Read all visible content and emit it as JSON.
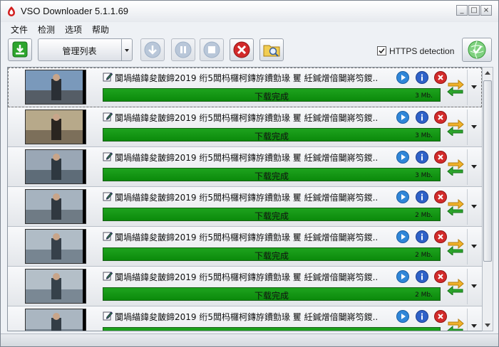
{
  "window": {
    "title": "VSO Downloader 5.1.1.69",
    "controls": {
      "minimize": "_",
      "maximize": "□",
      "close": "×"
    }
  },
  "menu": [
    {
      "label": "文件"
    },
    {
      "label": "检测"
    },
    {
      "label": "选项"
    },
    {
      "label": "帮助"
    }
  ],
  "toolbar": {
    "list_selector_label": "管理列表",
    "https_detection_label": "HTTPS detection",
    "https_detection_checked": true,
    "icons": {
      "download": "download-icon",
      "move_down": "arrow-down-icon",
      "pause": "pause-icon",
      "stop": "stop-icon",
      "cancel": "close-icon",
      "browse": "folder-search-icon",
      "status": "globe-check-icon"
    }
  },
  "downloads": [
    {
      "title": "闅堝緢鍏夋皵鍗2019 绗5闆杩欏柯鏄斿鐨勯瑑  矍   紝鍼熷偣闄嶈笉鍐..",
      "status": "下载完成",
      "size": "3 Mb."
    },
    {
      "title": "闅堝緢鍏夋皵鍗2019 绗5闆杩欏柯鏄斿鐨勯瑑  矍   紝鍼熷偣闄嶈笉鍐..",
      "status": "下载完成",
      "size": "3 Mb."
    },
    {
      "title": "闅堝緢鍏夋皵鍗2019 绗5闆杩欏柯鏄斿鐨勯瑑  矍   紝鍼熷偣闄嶈笉鍐..",
      "status": "下载完成",
      "size": "3 Mb."
    },
    {
      "title": "闅堝緢鍏夋皵鍗2019 绗5闆杩欏柯鏄斿鐨勯瑑  矍   紝鍼熷偣闄嶈笉鍐..",
      "status": "下载完成",
      "size": "2 Mb."
    },
    {
      "title": "闅堝緢鍏夋皵鍗2019 绗5闆杩欏柯鏄斿鐨勯瑑  矍   紝鍼熷偣闄嶈笉鍐..",
      "status": "下载完成",
      "size": "2 Mb."
    },
    {
      "title": "闅堝緢鍏夋皵鍗2019 绗5闆杩欏柯鏄斿鐨勯瑑  矍   紝鍼熷偣闄嶈笉鍐..",
      "status": "下载完成",
      "size": "2 Mb."
    },
    {
      "title": "闅堝緢鍏夋皵鍗2019 绗5闆杩欏柯鏄斿鐨勯瑑  矍   紝鍼熷偣闄嶈笉鍐..",
      "status": "",
      "size": ""
    }
  ],
  "colors": {
    "progress_fill": "#129812",
    "accent": "#2a7ad8",
    "cancel": "#d22a2a"
  }
}
